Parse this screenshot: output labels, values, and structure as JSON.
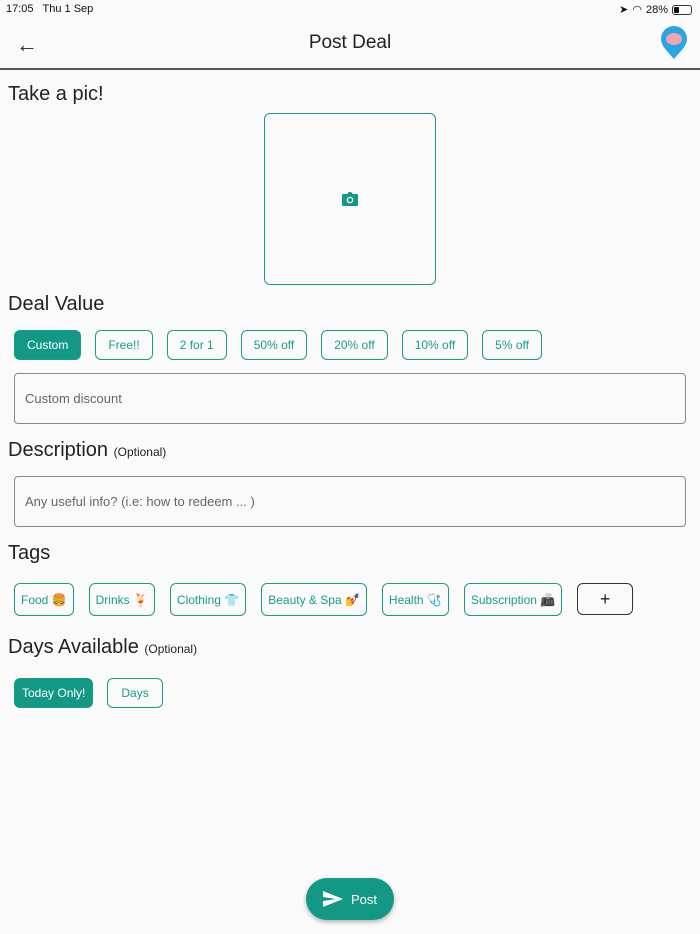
{
  "status": {
    "time": "17:05",
    "date": "Thu 1 Sep",
    "battery": "28%"
  },
  "header": {
    "title": "Post Deal"
  },
  "photo": {
    "heading": "Take a pic!"
  },
  "deal_value": {
    "heading": "Deal Value",
    "options": [
      "Custom",
      "Free!!",
      "2 for 1",
      "50% off",
      "20% off",
      "10% off",
      "5% off"
    ],
    "selected": "Custom",
    "placeholder": "Custom discount"
  },
  "description": {
    "heading": "Description",
    "optional": "(Optional)",
    "placeholder": "Any useful info? (i.e: how to redeem ... )"
  },
  "tags": {
    "heading": "Tags",
    "items": [
      "Food 🍔",
      "Drinks 🍹",
      "Clothing 👕",
      "Beauty & Spa 💅",
      "Health 🩺",
      "Subscription 📠"
    ],
    "add": "+"
  },
  "days": {
    "heading": "Days Available",
    "optional": "(Optional)",
    "options": [
      "Today Only!",
      "Days"
    ],
    "selected": "Today Only!"
  },
  "post": {
    "label": "Post"
  },
  "colors": {
    "accent": "#139886"
  }
}
